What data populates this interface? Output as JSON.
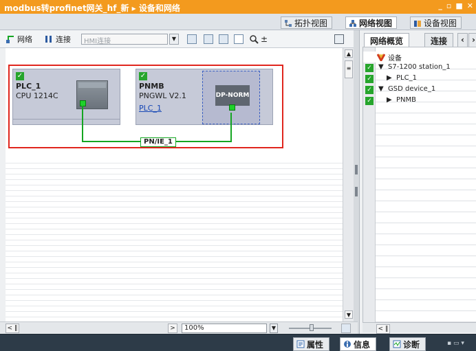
{
  "window": {
    "title": "modbus转profinet网关_hf_新 ▸ 设备和网络",
    "controls": [
      "_",
      "▫",
      "■",
      "✕"
    ]
  },
  "view_tabs": [
    {
      "label": "拓扑视图",
      "icon": "topology-icon"
    },
    {
      "label": "网络视图",
      "icon": "network-icon"
    },
    {
      "label": "设备视图",
      "icon": "device-icon"
    }
  ],
  "toolbar": {
    "network_label": "网络",
    "connect_label": "连接",
    "hmi_placeholder": "HMI连接"
  },
  "canvas": {
    "devices": [
      {
        "name": "PLC_1",
        "type": "CPU 1214C"
      },
      {
        "name": "PNMB",
        "type": "PNGWL V2.1",
        "link": "PLC_1",
        "module": "DP-NORM"
      }
    ],
    "network_label": "PN/IE_1",
    "zoom": "100%"
  },
  "overview": {
    "tabs": [
      "网络概览",
      "连接"
    ],
    "header": "设备",
    "rows": [
      {
        "label": "S7-1200 station_1",
        "level": 0,
        "expander": "▼"
      },
      {
        "label": "PLC_1",
        "level": 1,
        "expander": "▶"
      },
      {
        "label": "GSD device_1",
        "level": 0,
        "expander": "▼"
      },
      {
        "label": "PNMB",
        "level": 1,
        "expander": "▶"
      }
    ]
  },
  "bottom_tabs": [
    {
      "label": "属性",
      "icon": "properties-icon"
    },
    {
      "label": "信息",
      "icon": "info-icon"
    },
    {
      "label": "诊断",
      "icon": "diagnostics-icon"
    }
  ]
}
